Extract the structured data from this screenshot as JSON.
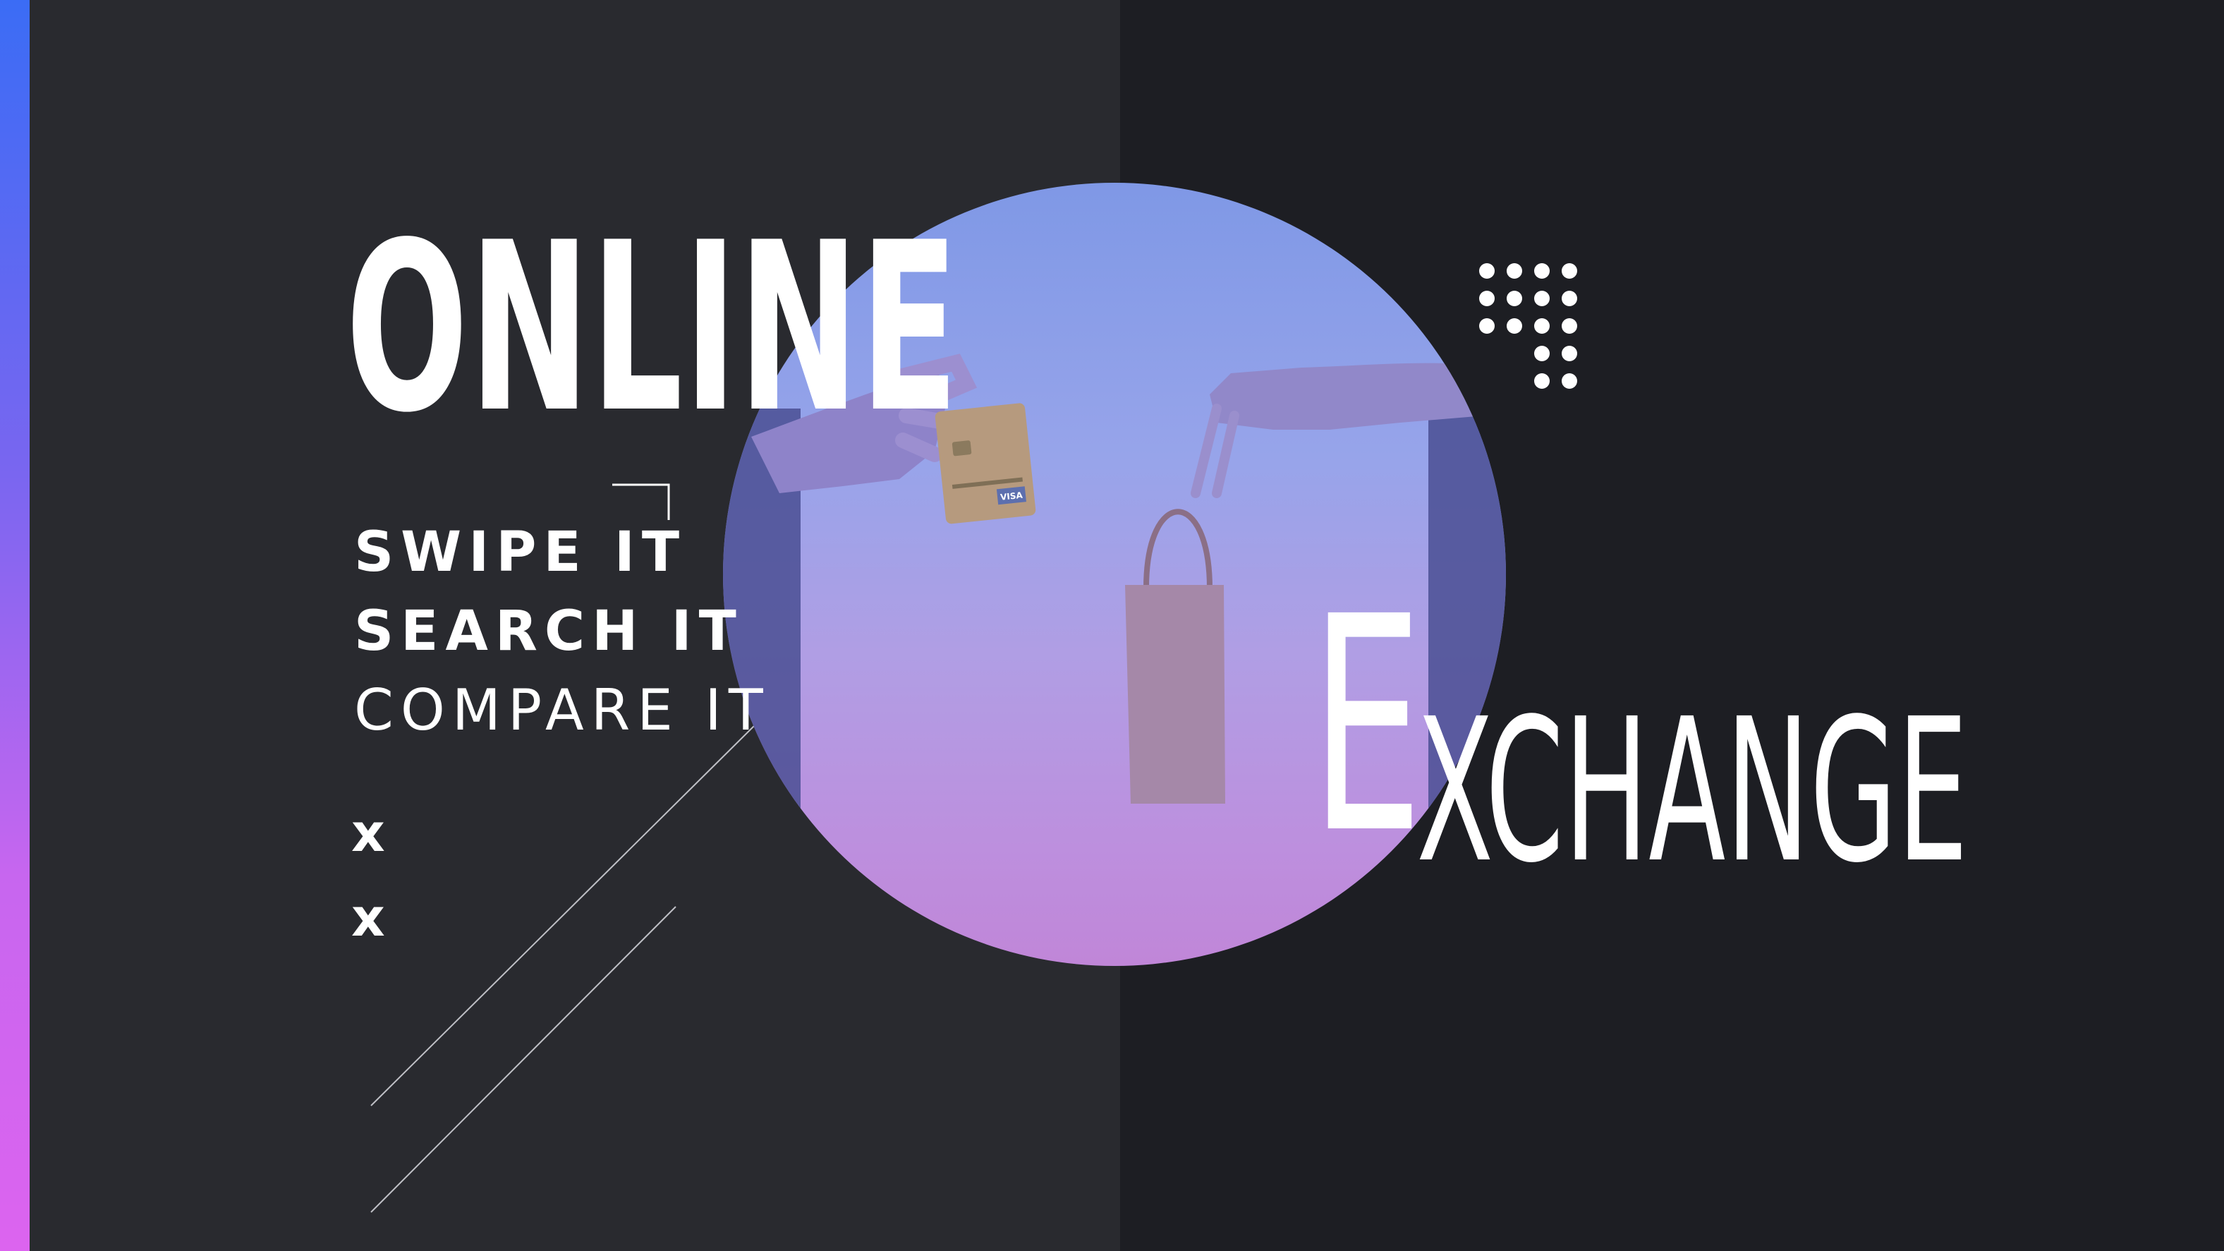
{
  "headline": {
    "online": "ONLINE",
    "exchange_first_letter": "E",
    "exchange_rest": "XCHANGE"
  },
  "taglines": [
    "SWIPE IT",
    "SEARCH IT",
    "COMPARE IT"
  ],
  "bullets": [
    "x",
    "x"
  ],
  "image": {
    "subject": "hands exchanging a credit card and a shopping bag from laptop screens",
    "card_text": "VISA"
  },
  "colors": {
    "left_panel": "#292a2f",
    "right_panel": "#1d1e23",
    "accent_top": "#3b6cf5",
    "accent_bottom": "#dc64ef",
    "text": "#ffffff"
  }
}
